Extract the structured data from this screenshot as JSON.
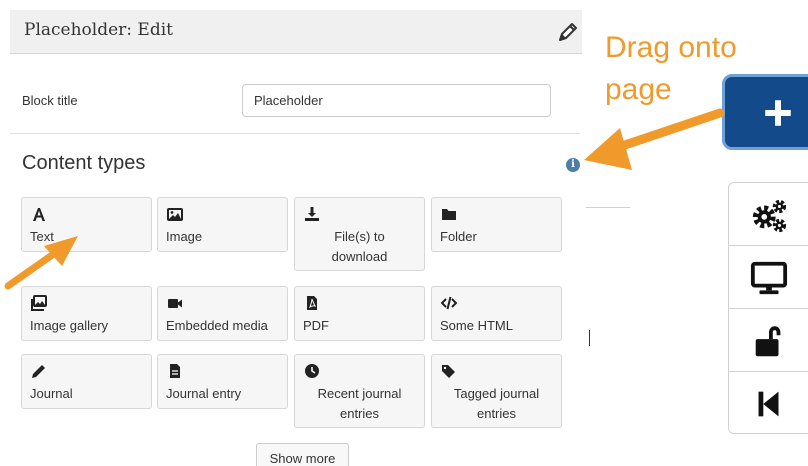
{
  "modal": {
    "title": "Placeholder: Edit",
    "block_title_label": "Block title",
    "block_title_value": "Placeholder",
    "content_heading": "Content types",
    "show_more_label": "Show more"
  },
  "content_types": [
    {
      "label": "Text",
      "icon": "text-icon"
    },
    {
      "label": "Image",
      "icon": "image-icon"
    },
    {
      "label": "File(s) to download",
      "line1": "File(s) to",
      "line2": "download",
      "icon": "download-icon"
    },
    {
      "label": "Folder",
      "icon": "folder-icon"
    },
    {
      "label": "Image gallery",
      "icon": "image-gallery-icon"
    },
    {
      "label": "Embedded media",
      "icon": "video-camera-icon"
    },
    {
      "label": "PDF",
      "icon": "pdf-file-icon"
    },
    {
      "label": "Some HTML",
      "icon": "code-icon"
    },
    {
      "label": "Journal",
      "icon": "pencil-icon"
    },
    {
      "label": "Journal entry",
      "icon": "document-icon"
    },
    {
      "label": "Recent journal entries",
      "line1": "Recent journal",
      "line2": "entries",
      "icon": "clock-icon"
    },
    {
      "label": "Tagged journal entries",
      "line1": "Tagged journal",
      "line2": "entries",
      "icon": "tags-icon"
    }
  ],
  "annotation": {
    "line1": "Drag onto",
    "line2": "page",
    "color": "#f09a2c"
  },
  "toolbar": {
    "add_button_color": "#134b8a",
    "icons": [
      "gears-icon",
      "monitor-icon",
      "unlock-icon",
      "skip-back-icon"
    ]
  }
}
